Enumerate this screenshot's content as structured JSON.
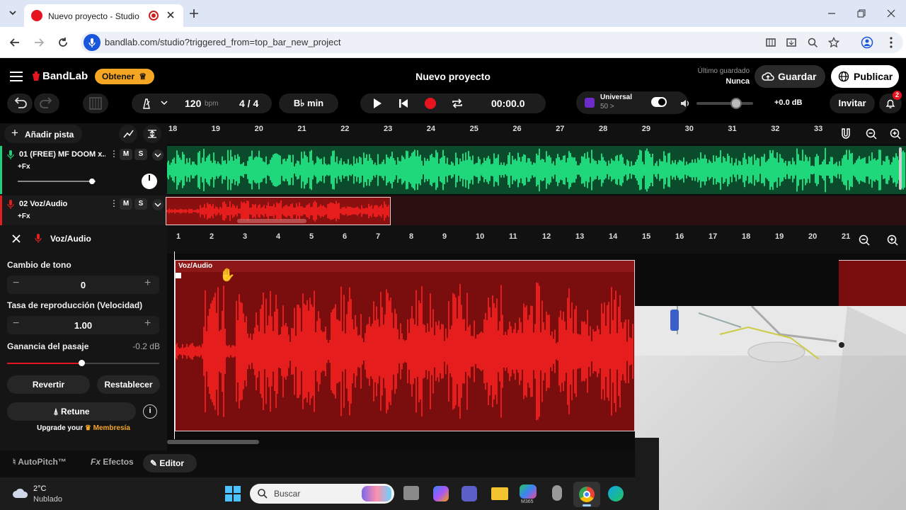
{
  "browser": {
    "tab_title": "Nuevo proyecto - Studio",
    "url": "bandlab.com/studio?triggered_from=top_bar_new_project"
  },
  "topbar": {
    "brand": "BandLab",
    "obtener": "Obtener",
    "project_title": "Nuevo proyecto",
    "saved_label": "Último guardado",
    "saved_value": "Nunca",
    "save": "Guardar",
    "publish": "Publicar"
  },
  "toolbar": {
    "bpm": "120",
    "bpm_unit": "bpm",
    "time_sig": "4 / 4",
    "key": "B♭ min",
    "time": "00:00.0",
    "universal": "Universal",
    "universal_sub": "50 >",
    "volume_db": "+0.0 dB",
    "invite": "Invitar",
    "notif_count": "2"
  },
  "add_track": "Añadir pista",
  "ruler_top": [
    "18",
    "19",
    "20",
    "21",
    "22",
    "23",
    "24",
    "25",
    "26",
    "27",
    "28",
    "29",
    "30",
    "31",
    "32",
    "33"
  ],
  "tracks": [
    {
      "name": "01  (FREE) MF DOOM x...",
      "fx": "+Fx",
      "mute": "M",
      "solo": "S",
      "color": "#1fd07a"
    },
    {
      "name": "02  Voz/Audio",
      "fx": "+Fx",
      "mute": "M",
      "solo": "S",
      "color": "#e01f1f"
    }
  ],
  "editor": {
    "track_name": "Voz/Audio",
    "clip_name": "Voz/Audio",
    "pitch_label": "Cambio de tono",
    "pitch_value": "0",
    "rate_label": "Tasa de reproducción (Velocidad)",
    "rate_value": "1.00",
    "gain_label": "Ganancia del pasaje",
    "gain_value": "-0.2 dB",
    "gain_level": 0.49,
    "revert": "Revertir",
    "reset": "Restablecer",
    "retune": "Retune",
    "upgrade_prefix": "Upgrade your",
    "upgrade_link": "Membresía",
    "tabs": [
      "AutoPitch™",
      "Efectos",
      "Editor"
    ],
    "ruler": [
      "1",
      "2",
      "3",
      "4",
      "5",
      "6",
      "7",
      "8",
      "9",
      "10",
      "11",
      "12",
      "13",
      "14",
      "15",
      "16",
      "17",
      "18",
      "19",
      "20",
      "21"
    ]
  },
  "taskbar": {
    "weather_temp": "2°C",
    "weather_desc": "Nublado",
    "search_placeholder": "Buscar",
    "m365": "M365"
  },
  "colors": {
    "accent_orange": "#f5a623",
    "record_red": "#e5141f",
    "green_wave": "#1fd87c",
    "red_wave": "#e51d1d"
  }
}
